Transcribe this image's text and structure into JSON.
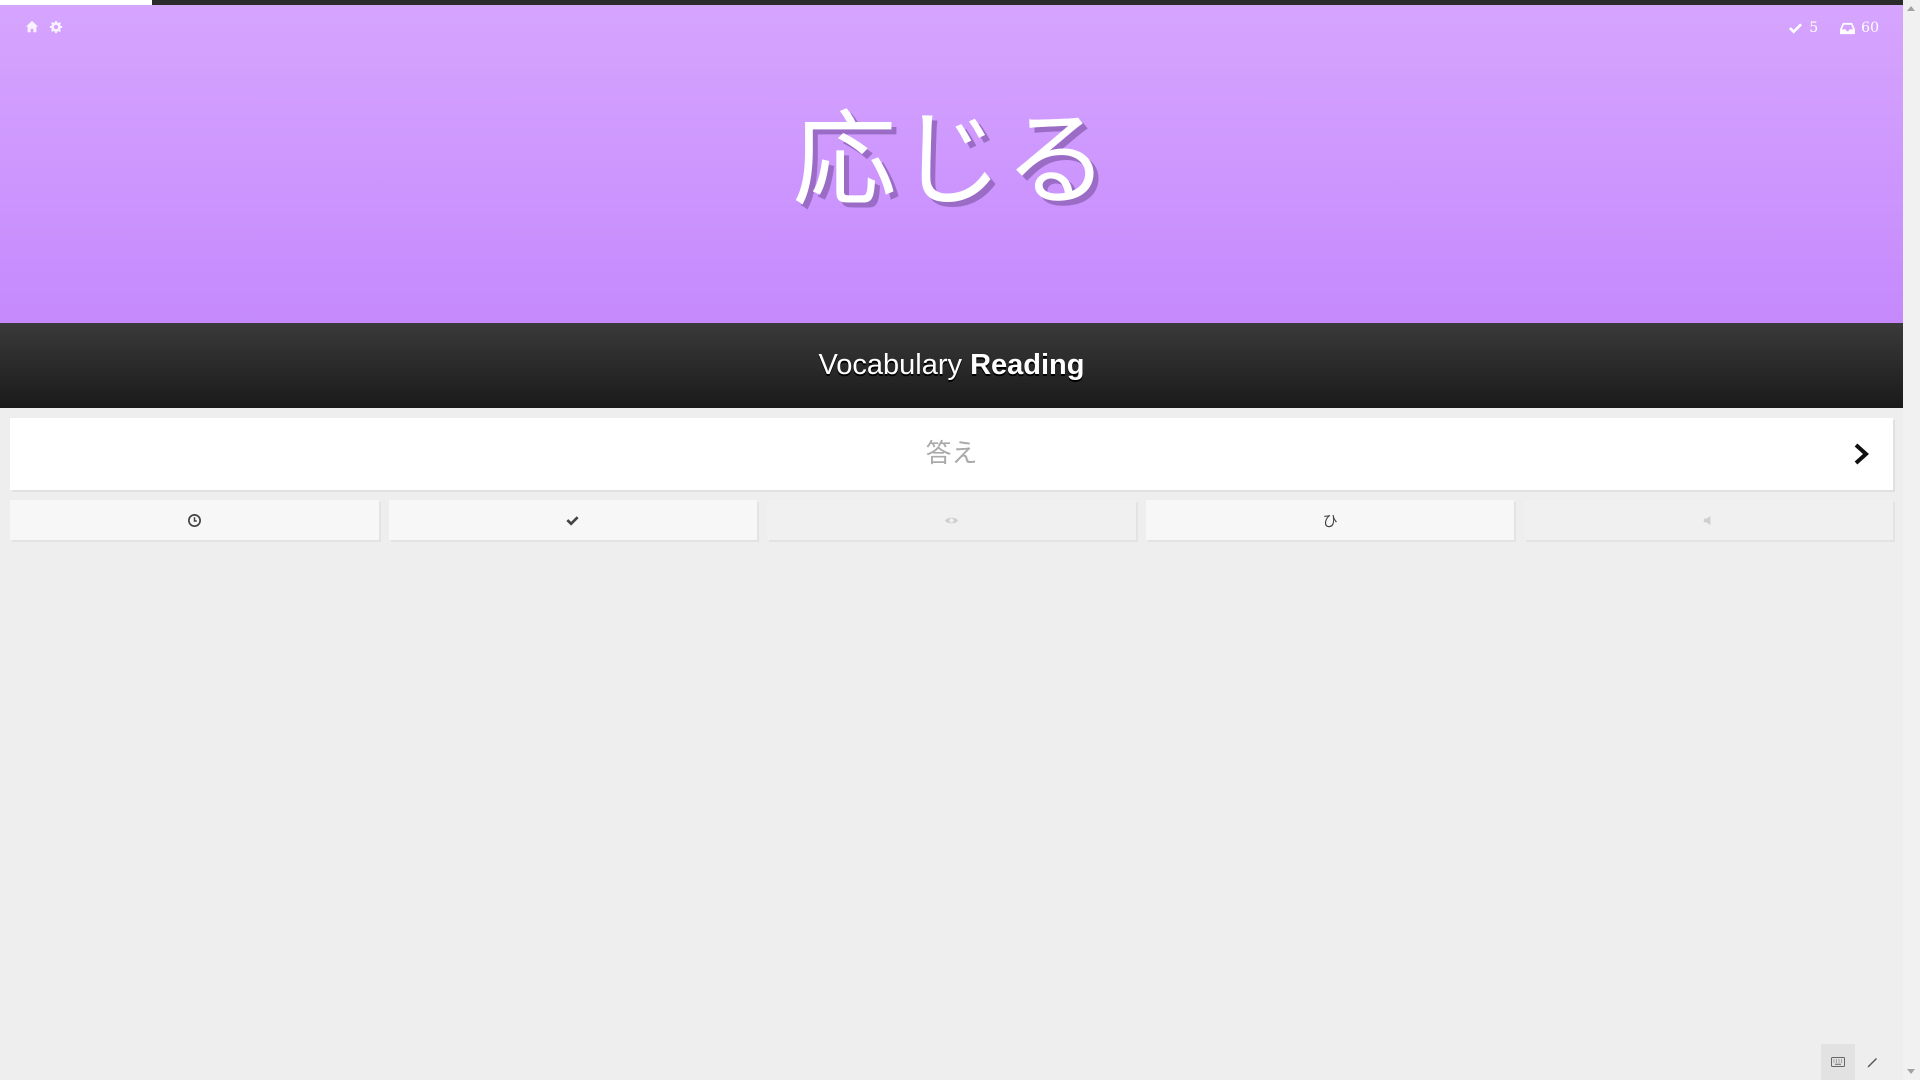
{
  "progress": {
    "completed_fraction": 0.08
  },
  "nav": {
    "home_icon": "home-icon",
    "settings_icon": "gear-icon"
  },
  "stats": {
    "completed_count": "5",
    "remaining_count": "60",
    "completed_icon": "check-icon",
    "remaining_icon": "inbox-icon"
  },
  "item": {
    "character": "応じる"
  },
  "question": {
    "category": "Vocabulary",
    "type": "Reading"
  },
  "answer": {
    "value": "",
    "placeholder": "答え",
    "submit_icon": "chevron-right-icon"
  },
  "actions": [
    {
      "icon": "clock-icon",
      "glyph": ""
    },
    {
      "icon": "check-icon",
      "glyph": ""
    },
    {
      "icon": "eye-icon",
      "glyph": ""
    },
    {
      "icon": "hiragana-icon",
      "glyph": "ひ"
    },
    {
      "icon": "speaker-icon",
      "glyph": ""
    }
  ],
  "colors": {
    "vocab_gradient_top": "#d6a5fe",
    "vocab_gradient_bottom": "#c589fd",
    "question_bar": "#1a1a1a",
    "background": "#eeeeee"
  }
}
